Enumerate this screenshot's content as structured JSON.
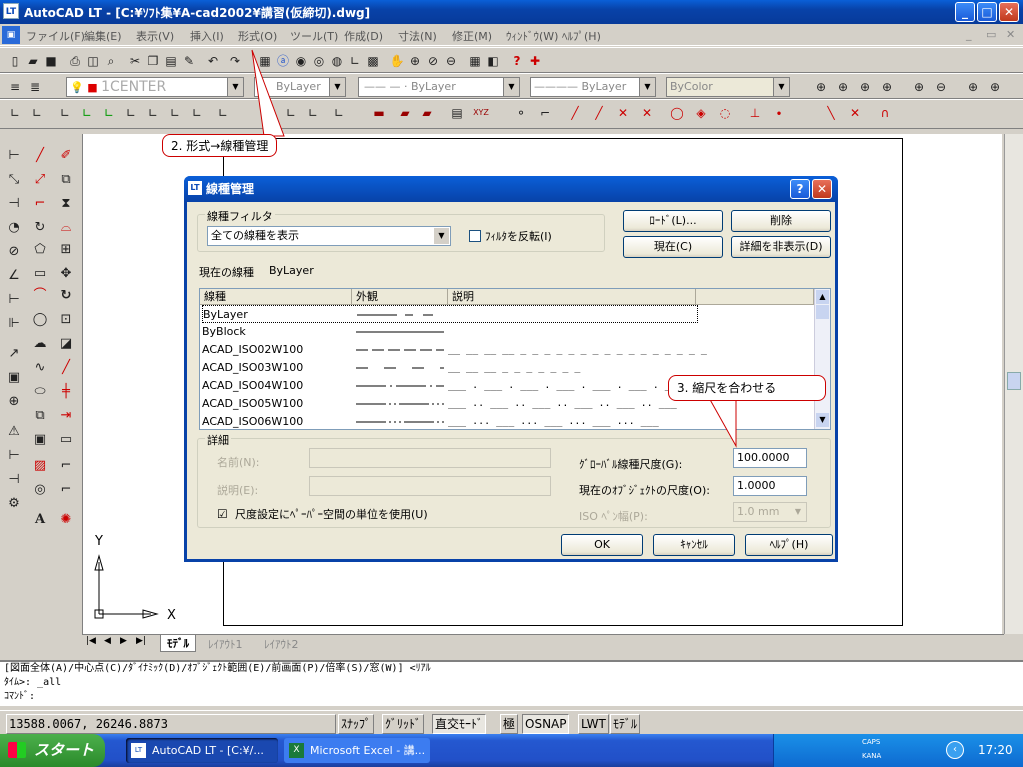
{
  "window": {
    "title": "AutoCAD LT - [C:¥ｿﾌﾄ集¥A-cad2002¥講習(仮締切).dwg]",
    "icon": "LT"
  },
  "menus": [
    "ファイル(F)",
    "編集(E)",
    "表示(V)",
    "挿入(I)",
    "形式(O)",
    "ツール(T)",
    "作成(D)",
    "寸法(N)",
    "修正(M)",
    "ｳｨﾝﾄﾞｳ(W)",
    "ﾍﾙﾌﾟ(H)"
  ],
  "toolbar": {
    "layer_name": "1CENTER",
    "color": "ByLayer",
    "linetype": "ByLayer",
    "lineweight": "ByLayer",
    "plotstyle": "ByColor"
  },
  "callouts": {
    "format_linetype": "2. 形式→線種管理",
    "scale_tip": "3. 縮尺を合わせる"
  },
  "dialog": {
    "title": "線種管理",
    "filter_group": "線種フィルタ",
    "filter_value": "全ての線種を表示",
    "invert_filter": "ﾌｨﾙﾀを反転(I)",
    "btn_load": "ﾛｰﾄﾞ(L)...",
    "btn_delete": "削除",
    "btn_current": "現在(C)",
    "btn_hide_details": "詳細を非表示(D)",
    "current_linetype_label": "現在の線種",
    "current_linetype_value": "ByLayer",
    "columns": [
      "線種",
      "外観",
      "説明"
    ],
    "rows": [
      {
        "name": "ByLayer",
        "desc": ""
      },
      {
        "name": "ByBlock",
        "desc": ""
      },
      {
        "name": "ACAD_ISO02W100",
        "desc": "__ __ __ __ _ _ _ _ _ _ _ _ _ _ _ _ _ _ _ _"
      },
      {
        "name": "ACAD_ISO03W100",
        "desc": "__  __  __  _    _    _    _    _    _    _"
      },
      {
        "name": "ACAD_ISO04W100",
        "desc": "___ . ___ . ___ . ___ . ___ . ___ . ___ ."
      },
      {
        "name": "ACAD_ISO05W100",
        "desc": "___ .. ___ .. ___ .. ___ .. ___ .. ___"
      },
      {
        "name": "ACAD_ISO06W100",
        "desc": "___ ... ___ ... ___ ... ___ ... ___"
      }
    ],
    "details_group": "詳細",
    "name_label": "名前(N):",
    "desc_label": "説明(E):",
    "paper_space_units": "尺度設定にﾍﾟｰﾊﾟｰ空間の単位を使用(U)",
    "global_scale_label": "ｸﾞﾛｰﾊﾞﾙ線種尺度(G):",
    "global_scale_value": "100.0000",
    "object_scale_label": "現在のｵﾌﾞｼﾞｪｸﾄの尺度(O):",
    "object_scale_value": "1.0000",
    "iso_pen_label": "ISO ﾍﾟﾝ幅(P):",
    "iso_pen_value": "1.0 mm",
    "btn_ok": "OK",
    "btn_cancel": "ｷｬﾝｾﾙ",
    "btn_help": "ﾍﾙﾌﾟ(H)"
  },
  "ucs": {
    "x": "X",
    "y": "Y"
  },
  "layout_tabs": [
    "ﾓﾃﾞﾙ",
    "ﾚｲｱｳﾄ1",
    "ﾚｲｱｳﾄ2"
  ],
  "command": {
    "line1": "[図面全体(A)/中心点(C)/ﾀﾞｲﾅﾐｯｸ(D)/ｵﾌﾞｼﾞｪｸﾄ範囲(E)/前画面(P)/倍率(S)/窓(W)] <ﾘｱﾙ",
    "line2": "ﾀｲﾑ>: _all",
    "line3": "ｺﾏﾝﾄﾞ:"
  },
  "status": {
    "coords": "13588.0067, 26246.8873",
    "buttons": [
      "ｽﾅｯﾌﾟ",
      "ｸﾞﾘｯﾄﾞ",
      "直交ﾓｰﾄﾞ",
      "極",
      "OSNAP",
      "LWT",
      "ﾓﾃﾞﾙ"
    ]
  },
  "taskbar": {
    "start": "スタート",
    "tasks": [
      "AutoCAD LT - [C:¥/...",
      "Microsoft Excel - 講..."
    ],
    "ime": "あ 般",
    "caps": "CAPS",
    "kana": "KANA",
    "clock": "17:20"
  }
}
